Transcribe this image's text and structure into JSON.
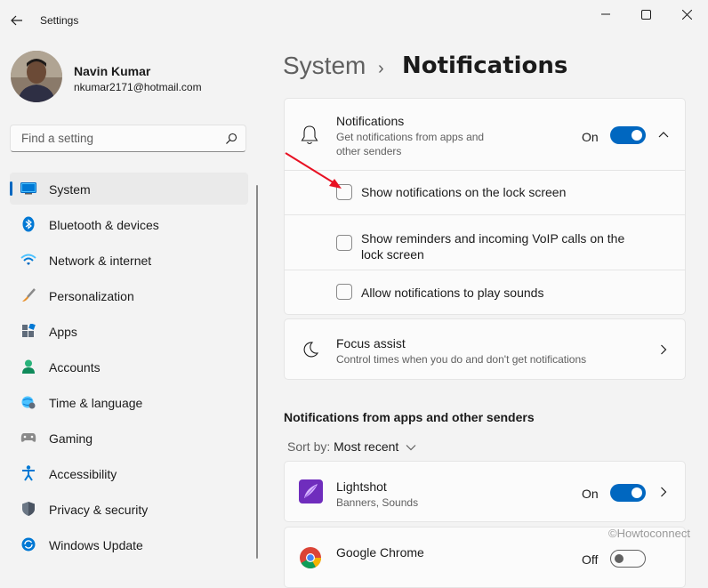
{
  "window": {
    "title": "Settings",
    "controls": [
      "minimize-icon",
      "maximize-icon",
      "close-icon"
    ]
  },
  "profile": {
    "name": "Navin Kumar",
    "email": "nkumar2171@hotmail.com"
  },
  "search": {
    "placeholder": "Find a setting"
  },
  "sidebar": {
    "items": [
      {
        "label": "System",
        "icon": "system-icon",
        "active": true
      },
      {
        "label": "Bluetooth & devices",
        "icon": "bluetooth-icon"
      },
      {
        "label": "Network & internet",
        "icon": "wifi-icon"
      },
      {
        "label": "Personalization",
        "icon": "brush-icon"
      },
      {
        "label": "Apps",
        "icon": "apps-icon"
      },
      {
        "label": "Accounts",
        "icon": "accounts-icon"
      },
      {
        "label": "Time & language",
        "icon": "globe-clock-icon"
      },
      {
        "label": "Gaming",
        "icon": "gamepad-icon"
      },
      {
        "label": "Accessibility",
        "icon": "accessibility-icon"
      },
      {
        "label": "Privacy & security",
        "icon": "shield-icon"
      },
      {
        "label": "Windows Update",
        "icon": "update-icon"
      }
    ]
  },
  "header": {
    "parent": "System",
    "separator": "›",
    "current": "Notifications"
  },
  "notifications": {
    "title": "Notifications",
    "subtitle_line1": "Get notifications from apps and",
    "subtitle_line2": "other senders",
    "state": "On",
    "options": {
      "lock_screen": "Show notifications on the lock screen",
      "reminders_line1": "Show reminders and incoming VoIP calls on the",
      "reminders_line2": "lock screen",
      "sounds": "Allow notifications to play sounds"
    }
  },
  "focus_assist": {
    "title": "Focus assist",
    "subtitle": "Control times when you do and don't get notifications"
  },
  "apps_section": {
    "title": "Notifications from apps and other senders",
    "sort_prefix": "Sort by:",
    "sort_value": "Most recent",
    "apps": [
      {
        "name": "Lightshot",
        "sub": "Banners, Sounds",
        "state": "On"
      },
      {
        "name": "Google Chrome",
        "state": "Off"
      }
    ]
  },
  "watermark": "©Howtoconnect",
  "colors": {
    "accent": "#0067c0",
    "background": "#f3f3f3",
    "card": "#fbfbfb",
    "annotation_arrow": "#e81123"
  }
}
